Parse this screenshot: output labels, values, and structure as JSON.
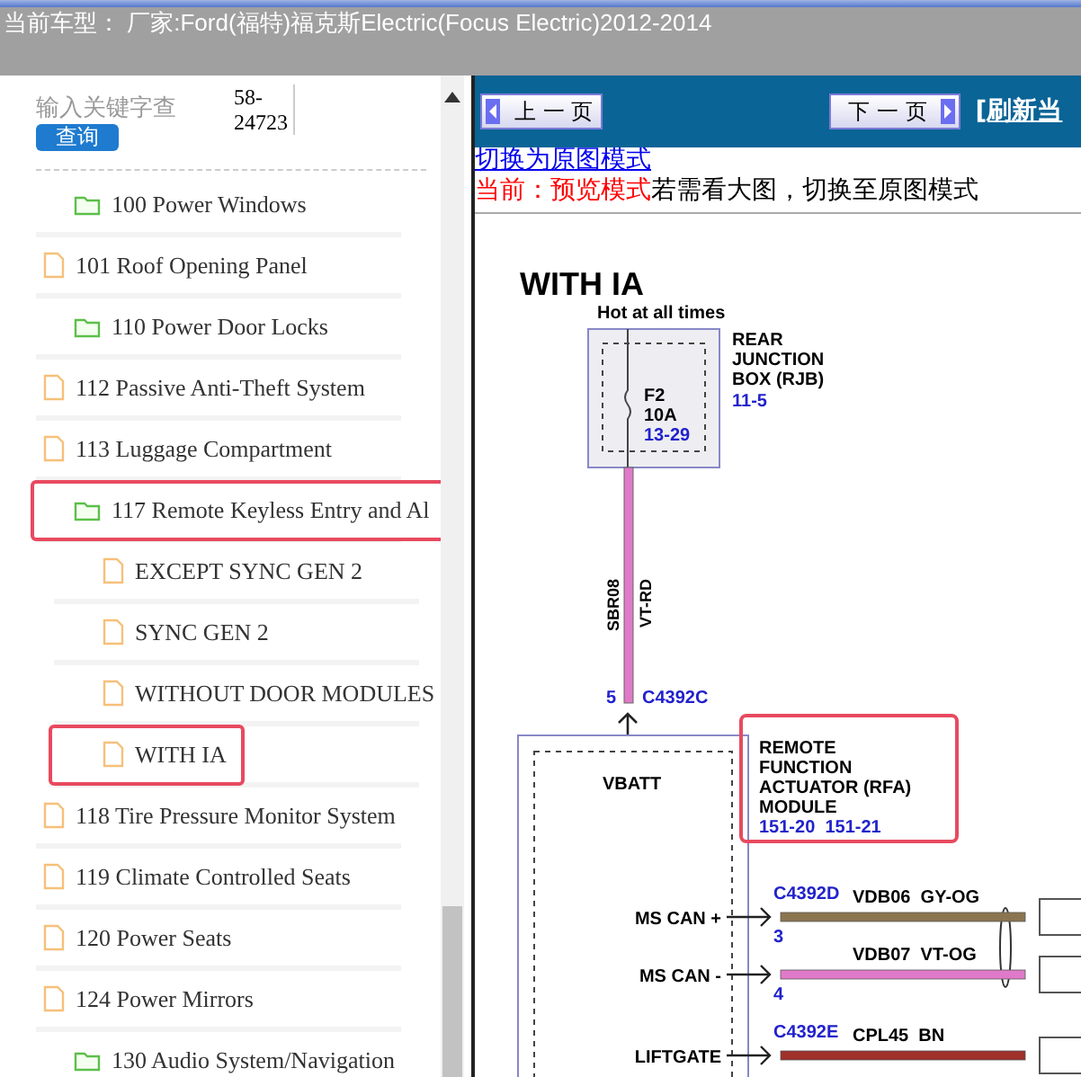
{
  "header": {
    "title": "当前车型： 厂家:Ford(福特)福克斯Electric(Focus Electric)2012-2014"
  },
  "search": {
    "placeholder": "输入关键字查",
    "button": "查询",
    "code": "58-\n24723"
  },
  "tree": [
    {
      "kind": "folder",
      "label": "100 Power Windows",
      "selected": false
    },
    {
      "kind": "file",
      "label": "101 Roof Opening Panel",
      "selected": false
    },
    {
      "kind": "folder",
      "label": "110 Power Door Locks",
      "selected": false
    },
    {
      "kind": "file",
      "label": "112 Passive Anti-Theft System",
      "selected": false
    },
    {
      "kind": "file",
      "label": "113 Luggage Compartment",
      "selected": false
    },
    {
      "kind": "folder",
      "label": "117 Remote Keyless Entry and Al",
      "selected": true,
      "children": [
        {
          "kind": "file",
          "label": "EXCEPT SYNC GEN 2",
          "selected": false
        },
        {
          "kind": "file",
          "label": "SYNC GEN 2",
          "selected": false
        },
        {
          "kind": "file",
          "label": "WITHOUT DOOR MODULES",
          "selected": false
        },
        {
          "kind": "file",
          "label": "WITH IA",
          "selected": true
        }
      ]
    },
    {
      "kind": "file",
      "label": "118 Tire Pressure Monitor System",
      "selected": false
    },
    {
      "kind": "file",
      "label": "119 Climate Controlled Seats",
      "selected": false
    },
    {
      "kind": "file",
      "label": "120 Power Seats",
      "selected": false
    },
    {
      "kind": "file",
      "label": "124 Power Mirrors",
      "selected": false
    },
    {
      "kind": "folder",
      "label": "130 Audio System/Navigation",
      "selected": false
    }
  ],
  "toolbar": {
    "prev": "上 一 页",
    "next": "下 一 页",
    "refresh": "[刷新当"
  },
  "mode_link": "切换为原图模式",
  "mode_note": {
    "current": "当前：预览模式",
    "hint": "若需看大图，切换至原图模式"
  },
  "diagram": {
    "title": "WITH IA",
    "supply": "Hot at all times",
    "fuse": [
      "F2",
      "10A"
    ],
    "fuse_ref": "13-29",
    "rjb": [
      "REAR",
      "JUNCTION",
      "BOX (RJB)"
    ],
    "rjb_ref": "11-5",
    "circuit": "SBR08",
    "wire_color": "VT-RD",
    "pin": "5",
    "connector": "C4392C",
    "pin_name": "VBATT",
    "module": [
      "REMOTE",
      "FUNCTION",
      "ACTUATOR (RFA)",
      "MODULE"
    ],
    "module_refs": "151-20  151-21",
    "signals": [
      {
        "name": "MS CAN +",
        "connector": "C4392D",
        "pin": "3",
        "wire": "VDB06  GY-OG",
        "color": "#8b7550"
      },
      {
        "name": "MS CAN -",
        "pin": "4",
        "wire": "VDB07  VT-OG",
        "color": "#e07ac8"
      },
      {
        "name": "LIFTGATE",
        "connector": "C4392E",
        "wire": "CPL45  BN",
        "color": "#a0302a"
      }
    ]
  }
}
